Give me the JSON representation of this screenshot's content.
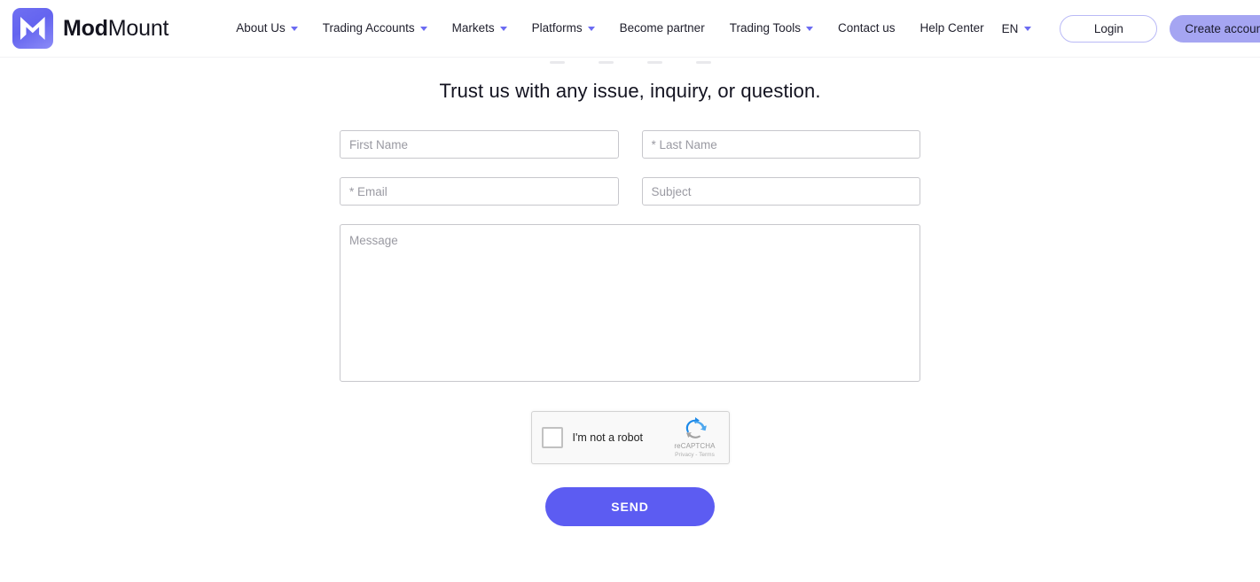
{
  "brand": {
    "name_bold": "Mod",
    "name_light": "Mount",
    "logo_icon": "modmount-m-logo-icon"
  },
  "nav": {
    "items": [
      {
        "label": "About Us",
        "has_dropdown": true
      },
      {
        "label": "Trading Accounts",
        "has_dropdown": true
      },
      {
        "label": "Markets",
        "has_dropdown": true
      },
      {
        "label": "Platforms",
        "has_dropdown": true
      },
      {
        "label": "Become partner",
        "has_dropdown": false
      },
      {
        "label": "Trading Tools",
        "has_dropdown": true
      },
      {
        "label": "Contact us",
        "has_dropdown": false
      },
      {
        "label": "Help Center",
        "has_dropdown": false
      }
    ]
  },
  "header_right": {
    "language": "EN",
    "login_label": "Login",
    "create_account_label": "Create account"
  },
  "main": {
    "heading": "Trust us with any issue, inquiry, or question."
  },
  "form": {
    "first_name": {
      "placeholder": "First Name",
      "value": ""
    },
    "last_name": {
      "placeholder": "* Last Name",
      "value": ""
    },
    "email": {
      "placeholder": "* Email",
      "value": ""
    },
    "subject": {
      "placeholder": "Subject",
      "value": ""
    },
    "message": {
      "placeholder": "Message",
      "value": ""
    },
    "send_label": "SEND"
  },
  "recaptcha": {
    "label": "I'm not a robot",
    "brand": "reCAPTCHA",
    "privacy": "Privacy",
    "separator": "-",
    "terms": "Terms",
    "checked": false
  },
  "colors": {
    "accent": "#5c5cf2",
    "accent_soft": "#a5a5f2",
    "caret": "#6b6bf2",
    "text": "#1b1b29",
    "placeholder": "#9a9aa2",
    "border": "#c7c7cc"
  }
}
